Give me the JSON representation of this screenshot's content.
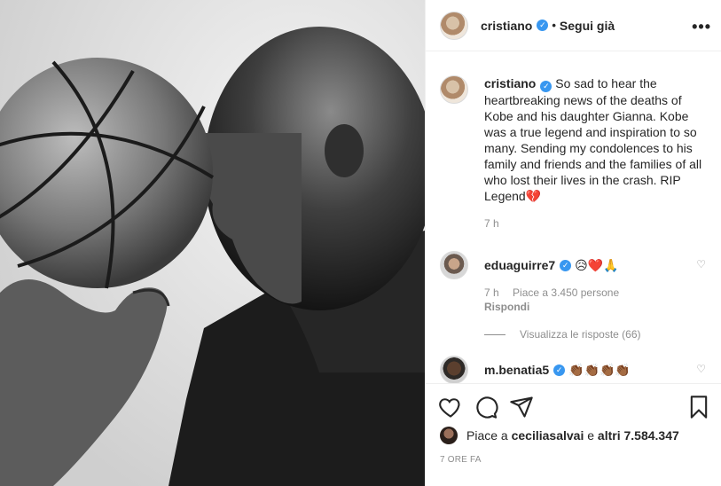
{
  "header": {
    "username": "cristiano",
    "follow_label": "Segui già",
    "dot": "•",
    "more": "•••"
  },
  "caption": {
    "username": "cristiano",
    "text": "So sad to hear the heartbreaking news of the deaths of Kobe and his daughter Gianna. Kobe was a true legend and inspiration to so many. Sending my condolences to his family and friends and the families of all who lost their lives in the crash. RIP Legend",
    "heart": "💔",
    "time": "7 h"
  },
  "comments": [
    {
      "username": "eduaguirre7",
      "emojis": "😥❤️🙏",
      "time": "7 h",
      "likes": "Piace a 3.450 persone",
      "reply": "Rispondi",
      "view_replies": "Visualizza le risposte (66)"
    },
    {
      "username": "m.benatia5",
      "emojis": "👏🏾👏🏾👏🏾👏🏾"
    }
  ],
  "likes_line": {
    "prefix": "Piace a",
    "user": "ceciliasalvai",
    "middle": "e",
    "others": "altri 7.584.347"
  },
  "posted_ago": "7 ORE FA",
  "icons": [
    "heart-icon",
    "comment-icon",
    "share-icon",
    "bookmark-icon",
    "like-small-icon",
    "verified-icon",
    "more-icon"
  ],
  "colors": {
    "verified": "#3897f0",
    "secondary_text": "#8e8e8e",
    "heart": "#d0021b"
  }
}
